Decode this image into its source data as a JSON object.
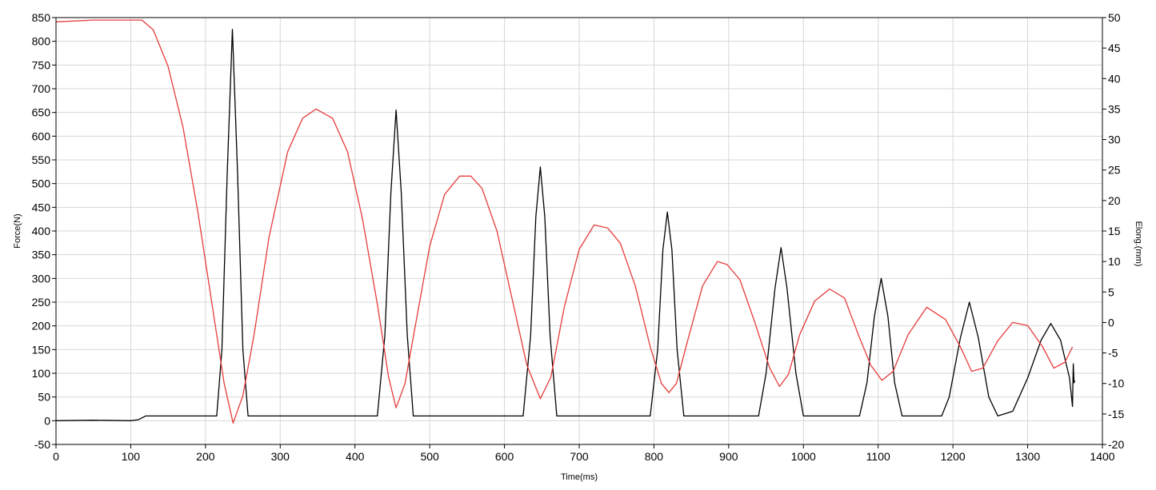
{
  "chart_data": {
    "type": "line",
    "xlabel": "Time(ms)",
    "ylabel": "Force(N)",
    "y2label": "Elong.(mm)",
    "xlim": [
      0,
      1400
    ],
    "ylim": [
      -50,
      850
    ],
    "y2lim": [
      -20,
      50
    ],
    "x_ticks": [
      0,
      100,
      200,
      300,
      400,
      500,
      600,
      700,
      800,
      900,
      1000,
      1100,
      1200,
      1300,
      1400
    ],
    "y_ticks": [
      -50,
      0,
      50,
      100,
      150,
      200,
      250,
      300,
      350,
      400,
      450,
      500,
      550,
      600,
      650,
      700,
      750,
      800,
      850
    ],
    "y2_ticks": [
      -20,
      -15,
      -10,
      -5,
      0,
      5,
      10,
      15,
      20,
      25,
      30,
      35,
      40,
      45,
      50
    ],
    "grid": true,
    "legend": "none",
    "series": [
      {
        "axis": "left",
        "color": "#000000",
        "x": [
          0,
          50,
          100,
          110,
          120,
          215,
          222,
          229,
          236,
          243,
          250,
          257,
          264,
          430,
          440,
          448,
          455,
          462,
          470,
          478,
          625,
          635,
          642,
          648,
          654,
          661,
          670,
          795,
          805,
          812,
          818,
          824,
          831,
          840,
          940,
          950,
          962,
          970,
          978,
          990,
          1000,
          1075,
          1085,
          1095,
          1104,
          1113,
          1122,
          1132,
          1185,
          1195,
          1210,
          1222,
          1234,
          1248,
          1260,
          1280,
          1300,
          1318,
          1331,
          1344,
          1356,
          1358,
          1360,
          1361,
          1362,
          1363
        ],
        "y": [
          0,
          1,
          0,
          2,
          10,
          10,
          150,
          520,
          825,
          520,
          150,
          10,
          10,
          10,
          180,
          480,
          655,
          480,
          180,
          10,
          10,
          180,
          430,
          535,
          430,
          180,
          10,
          10,
          150,
          360,
          440,
          360,
          150,
          10,
          10,
          100,
          280,
          365,
          280,
          100,
          10,
          10,
          80,
          220,
          300,
          220,
          80,
          10,
          10,
          50,
          175,
          250,
          175,
          50,
          10,
          20,
          90,
          170,
          205,
          170,
          90,
          60,
          30,
          120,
          80,
          85
        ]
      },
      {
        "axis": "right",
        "color": "#e63b3b",
        "x": [
          0,
          50,
          100,
          115,
          130,
          150,
          170,
          190,
          210,
          225,
          237,
          250,
          265,
          285,
          310,
          330,
          348,
          370,
          390,
          410,
          430,
          445,
          455,
          467,
          480,
          500,
          520,
          540,
          555,
          570,
          590,
          610,
          630,
          648,
          662,
          680,
          700,
          720,
          738,
          755,
          775,
          795,
          810,
          820,
          830,
          845,
          865,
          885,
          898,
          915,
          935,
          955,
          968,
          980,
          995,
          1015,
          1035,
          1055,
          1075,
          1090,
          1105,
          1120,
          1140,
          1165,
          1190,
          1210,
          1225,
          1240,
          1260,
          1280,
          1300,
          1320,
          1335,
          1350,
          1360
        ],
        "y": [
          49.3,
          49.6,
          49.6,
          49.6,
          48.0,
          42.0,
          32.0,
          18.0,
          2.0,
          -10.0,
          -16.5,
          -12.0,
          -2.0,
          14.0,
          28.0,
          33.5,
          35.0,
          33.5,
          28.0,
          17.0,
          3.0,
          -9.0,
          -14.0,
          -10.0,
          -1.0,
          12.5,
          21.0,
          24.0,
          24.0,
          22.0,
          15.0,
          4.0,
          -7.0,
          -12.5,
          -9.0,
          2.5,
          12.0,
          16.0,
          15.5,
          13.0,
          6.0,
          -4.0,
          -10.0,
          -11.5,
          -10.0,
          -3.0,
          6.0,
          10.0,
          9.5,
          7.0,
          0.0,
          -7.5,
          -10.5,
          -8.5,
          -2.0,
          3.5,
          5.5,
          4.0,
          -2.5,
          -7.0,
          -9.5,
          -8.0,
          -2.0,
          2.5,
          0.5,
          -4.0,
          -8.0,
          -7.5,
          -3.0,
          0.0,
          -0.5,
          -4.0,
          -7.5,
          -6.5,
          -4.0
        ]
      }
    ]
  }
}
